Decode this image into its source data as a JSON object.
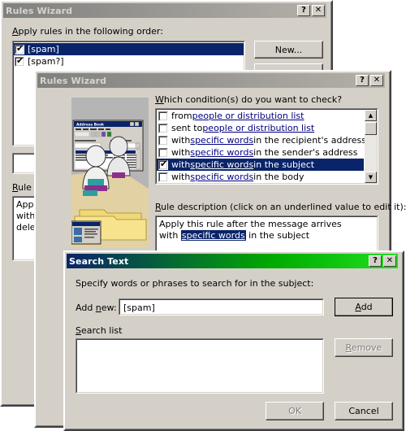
{
  "dialog1": {
    "title": "Rules Wizard",
    "titlebar_buttons": [
      "?",
      "✕"
    ],
    "prompt": "Apply rules in the following order:",
    "rules": [
      {
        "label": "[spam]",
        "checked": true,
        "selected": true
      },
      {
        "label": "[spam?]",
        "checked": true,
        "selected": false
      }
    ],
    "buttons": {
      "new": "New...",
      "second": ""
    },
    "rule_description_label": "Rule d",
    "rule_description_lines": [
      "Appl",
      "with",
      "delet"
    ],
    "help_button": "?"
  },
  "dialog2": {
    "title": "Rules Wizard",
    "titlebar_buttons": [
      "?",
      "✕"
    ],
    "question": "Which condition(s) do you want to check?",
    "conditions": [
      {
        "pre": "from ",
        "link": "people or distribution list",
        "post": "",
        "checked": false,
        "selected": false
      },
      {
        "pre": "sent to ",
        "link": "people or distribution list",
        "post": "",
        "checked": false,
        "selected": false
      },
      {
        "pre": "with ",
        "link": "specific words",
        "post": " in the recipient's address",
        "checked": false,
        "selected": false
      },
      {
        "pre": "with ",
        "link": "specific words",
        "post": " in the sender's address",
        "checked": false,
        "selected": false
      },
      {
        "pre": "with ",
        "link": "specific words",
        "post": " in the subject",
        "checked": true,
        "selected": true
      },
      {
        "pre": "with ",
        "link": "specific words",
        "post": " in the body",
        "checked": false,
        "selected": false
      }
    ],
    "scroll": {
      "up": "▲",
      "down": "▼"
    },
    "rule_description_label": "Rule description (click on an underlined value to edit it):",
    "rule_description": {
      "line1": "Apply this rule after the message arrives",
      "line2_pre": "with ",
      "line2_highlight": "specific words",
      "line2_post": " in the subject"
    },
    "illustration": {
      "window_title": "Address Book",
      "alt": "wizard illustration: address book window, people and folders"
    }
  },
  "dialog3": {
    "title": "Search Text",
    "titlebar_buttons": [
      "?",
      "✕"
    ],
    "prompt": "Specify words or phrases to search for in the subject:",
    "add_new_label": "Add new:",
    "add_new_value": "[spam]",
    "add_new_placeholder": "",
    "add_button": "Add",
    "search_list_label": "Search list",
    "search_list_items": [],
    "remove_button": "Remove",
    "remove_enabled": false,
    "ok_button": "OK",
    "ok_enabled": false,
    "cancel_button": "Cancel",
    "cancel_enabled": true
  },
  "colors": {
    "face": "#d4d0c8",
    "selection": "#0a246a",
    "link": "#00007f",
    "active_title_start": "#0a246a",
    "active_title_end": "#20e020",
    "inactive_title_start": "#808080",
    "inactive_title_end": "#b4b0a8"
  }
}
